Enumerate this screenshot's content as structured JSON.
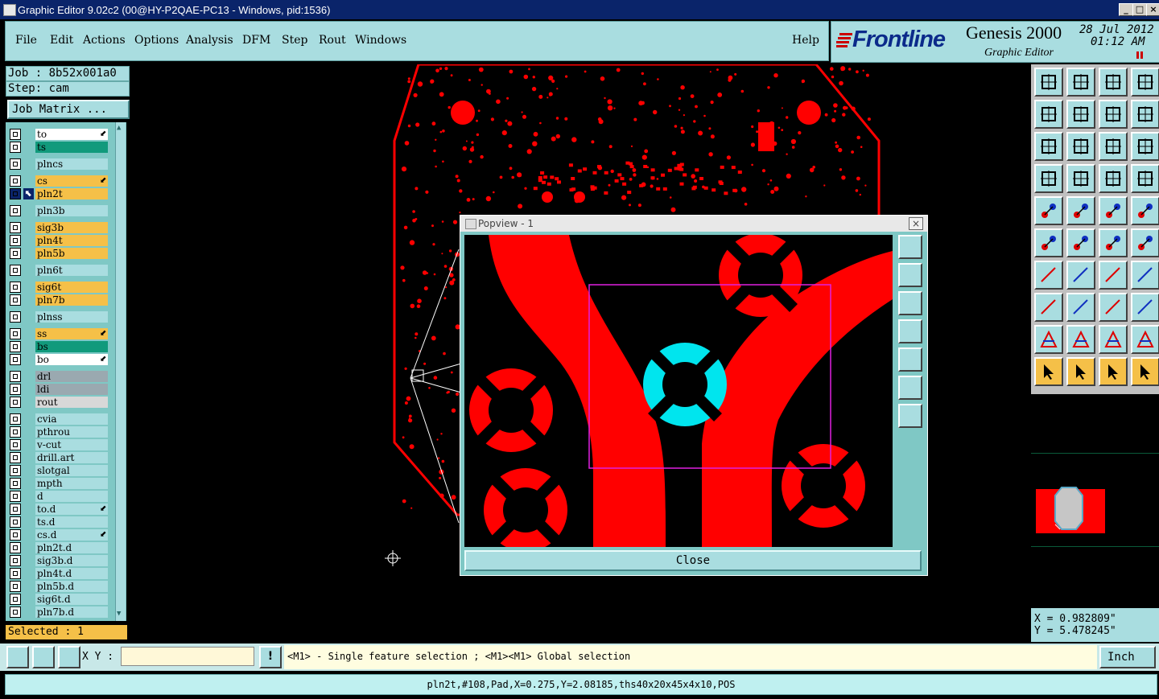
{
  "window": {
    "title": "Graphic Editor 9.02c2 (00@HY-P2QAE-PC13 - Windows, pid:1536)"
  },
  "menu": {
    "items": [
      "File",
      "Edit",
      "Actions",
      "Options",
      "Analysis",
      "DFM",
      "Step",
      "Rout",
      "Windows"
    ],
    "help": "Help"
  },
  "brand": {
    "logo": "Frontline",
    "product": "Genesis 2000",
    "subtitle": "Graphic Editor",
    "date": "28 Jul 2012",
    "time": "01:12 AM"
  },
  "job": {
    "job_line": "Job : 8b52x001a0",
    "step_line": "Step: cam",
    "matrix_button": "Job Matrix ..."
  },
  "layers": [
    {
      "name": "to",
      "color": "#ffffff",
      "mark": true
    },
    {
      "name": "ts",
      "color": "#119a7c"
    },
    {
      "name": "plncs",
      "color": "#a9dde0"
    },
    {
      "name": "cs",
      "color": "#f5c048",
      "mark": true
    },
    {
      "name": "pln2t",
      "color": "#f5c048",
      "active": true
    },
    {
      "name": "pln3b",
      "color": "#a9dde0"
    },
    {
      "name": "sig3b",
      "color": "#f5c048"
    },
    {
      "name": "pln4t",
      "color": "#f5c048"
    },
    {
      "name": "pln5b",
      "color": "#f5c048"
    },
    {
      "name": "pln6t",
      "color": "#a9dde0"
    },
    {
      "name": "sig6t",
      "color": "#f5c048"
    },
    {
      "name": "pln7b",
      "color": "#f5c048"
    },
    {
      "name": "plnss",
      "color": "#a9dde0"
    },
    {
      "name": "ss",
      "color": "#f5c048",
      "mark": true
    },
    {
      "name": "bs",
      "color": "#119a7c"
    },
    {
      "name": "bo",
      "color": "#ffffff",
      "mark": true
    },
    {
      "name": "drl",
      "color": "#9aa9b0"
    },
    {
      "name": "ldi",
      "color": "#9aa9b0"
    },
    {
      "name": "rout",
      "color": "#d8d8d8"
    },
    {
      "name": "cvia",
      "color": "#a9dde0"
    },
    {
      "name": "pthrou",
      "color": "#a9dde0"
    },
    {
      "name": "v-cut",
      "color": "#a9dde0"
    },
    {
      "name": "drill.art",
      "color": "#a9dde0"
    },
    {
      "name": "slotgal",
      "color": "#a9dde0"
    },
    {
      "name": "mpth",
      "color": "#a9dde0"
    },
    {
      "name": "d",
      "color": "#a9dde0"
    },
    {
      "name": "to.d",
      "color": "#a9dde0",
      "mark": true
    },
    {
      "name": "ts.d",
      "color": "#a9dde0"
    },
    {
      "name": "cs.d",
      "color": "#a9dde0",
      "mark": true
    },
    {
      "name": "pln2t.d",
      "color": "#a9dde0"
    },
    {
      "name": "sig3b.d",
      "color": "#a9dde0"
    },
    {
      "name": "pln4t.d",
      "color": "#a9dde0"
    },
    {
      "name": "pln5b.d",
      "color": "#a9dde0"
    },
    {
      "name": "sig6t.d",
      "color": "#a9dde0"
    },
    {
      "name": "pln7b.d",
      "color": "#a9dde0"
    }
  ],
  "selected": "Selected : 1",
  "bottom": {
    "xy_label": "X Y :",
    "xy_value": "",
    "hint": "<M1> - Single feature selection ; <M1><M1> Global selection",
    "units": "Inch"
  },
  "status": "pln2t,#108,Pad,X=0.275,Y=2.08185,ths40x20x45x4x10,POS",
  "coords": {
    "x": "X = 0.982809\"",
    "y": "Y = 5.478245\""
  },
  "popview": {
    "title": "Popview - 1",
    "close_label": "Close"
  },
  "colors": {
    "copper": "#ff0000",
    "highlight": "#00e5ee",
    "zoom_frame": "#e020e0",
    "panel": "#a9dde0"
  }
}
